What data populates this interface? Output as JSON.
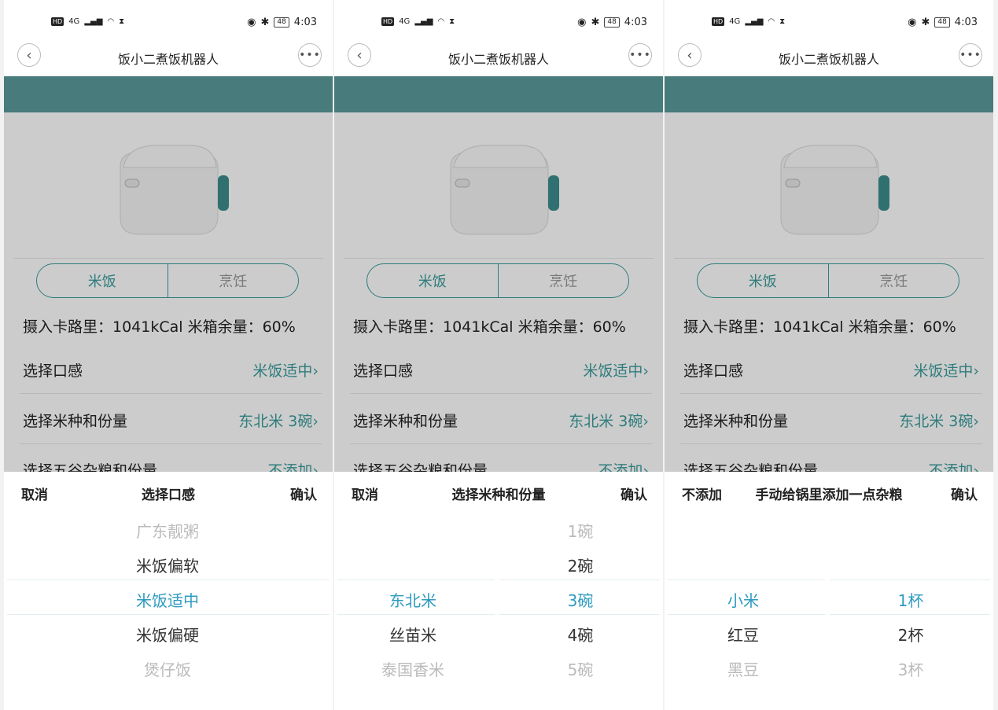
{
  "status": {
    "network": "4G",
    "battery": "48",
    "time": "4:03"
  },
  "header": {
    "title": "饭小二煮饭机器人"
  },
  "tabs": {
    "rice": "米饭",
    "cook": "烹饪"
  },
  "stats": "摄入卡路里：1041kCal   米箱余量：60%",
  "rows": {
    "texture": {
      "label": "选择口感",
      "value": "米饭适中"
    },
    "rice": {
      "label": "选择米种和份量",
      "value": "东北米 3碗"
    },
    "grain": {
      "label": "选择五谷杂粮和份量",
      "value": "不添加"
    }
  },
  "pickers": [
    {
      "cancel": "取消",
      "title": "选择口感",
      "confirm": "确认",
      "col1": [
        "广东靓粥",
        "米饭偏软",
        "米饭适中",
        "米饭偏硬",
        "煲仔饭"
      ]
    },
    {
      "cancel": "取消",
      "title": "选择米种和份量",
      "confirm": "确认",
      "col1": [
        "东北米",
        "丝苗米",
        "泰国香米"
      ],
      "col2": [
        "1碗",
        "2碗",
        "3碗",
        "4碗",
        "5碗"
      ]
    },
    {
      "cancel": "不添加",
      "title": "手动给锅里添加一点杂粮",
      "confirm": "确认",
      "col1": [
        "小米",
        "红豆",
        "黑豆"
      ],
      "col2": [
        "1杯",
        "2杯",
        "3杯"
      ]
    }
  ],
  "colors": {
    "teal": "#5a9a9a",
    "accent": "#3c9c9c",
    "selected": "#2f9bc0"
  }
}
